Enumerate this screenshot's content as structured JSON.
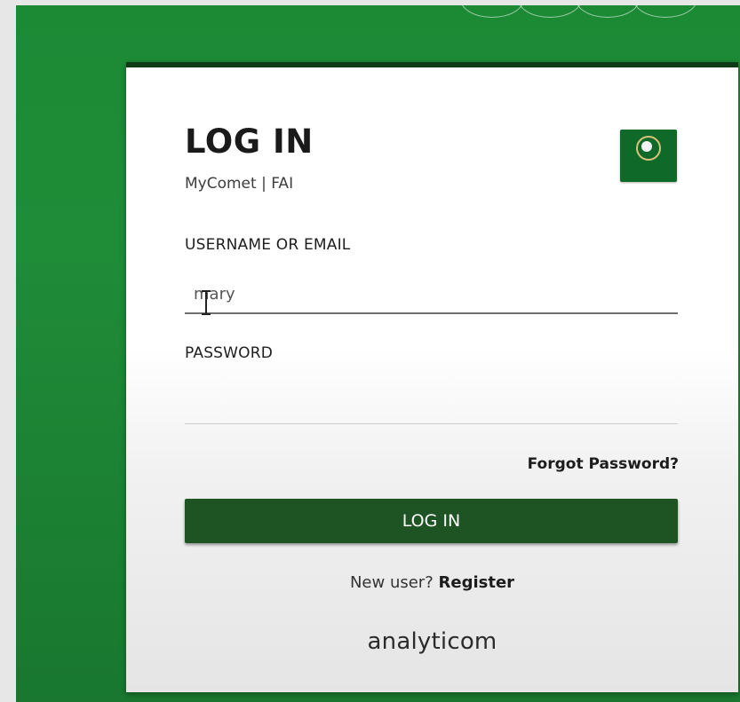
{
  "colors": {
    "background_green": "#1f8c38",
    "button_green": "#1e5424",
    "card_border": "#0e3a18",
    "logo_green": "#0f6a2a"
  },
  "login_card": {
    "title": "LOG IN",
    "subtitle": "MyComet | FAI",
    "logo_icon": "fai-comet-logo-icon"
  },
  "form": {
    "username_label": "USERNAME OR EMAIL",
    "username_value": "mary",
    "password_label": "PASSWORD",
    "password_value": "",
    "forgot_password": "Forgot Password?",
    "submit_label": "LOG IN"
  },
  "register": {
    "prompt": "New user?",
    "link": "Register"
  },
  "brand": {
    "name": "analyticom"
  }
}
